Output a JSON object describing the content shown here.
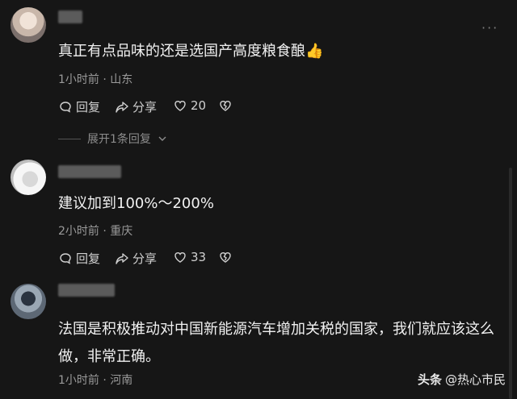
{
  "comments": [
    {
      "text": "真正有点品味的还是选国产高度粮食酿",
      "emoji": "👍",
      "meta": "1小时前 · 山东",
      "reply_label": "回复",
      "share_label": "分享",
      "likes": "20",
      "expand_label": "展开1条回复"
    },
    {
      "text": "建议加到100%～200%",
      "meta": "2小时前 · 重庆",
      "reply_label": "回复",
      "share_label": "分享",
      "likes": "33"
    },
    {
      "text": "法国是积极推动对中国新能源汽车增加关税的国家，我们就应该这么做，非常正确。",
      "meta": "1小时前 · 河南"
    }
  ],
  "watermark": {
    "brand": "头条",
    "handle": "@热心市民"
  },
  "icons": {
    "reply": "comment-bubble-icon",
    "share": "share-arrow-icon",
    "like": "heart-icon",
    "dislike": "broken-heart-icon",
    "more": "more-dots-icon",
    "expand": "chevron-down-icon"
  },
  "colors": {
    "background": "#161616",
    "text": "#f1f1f1",
    "meta": "#9a9a9a"
  }
}
